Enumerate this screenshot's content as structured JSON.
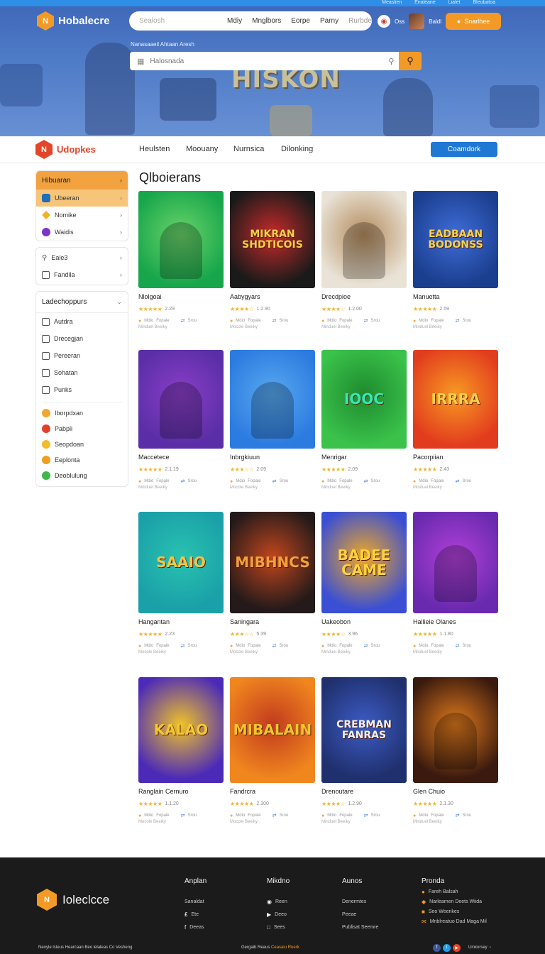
{
  "hero": {
    "top_links": [
      "Measlien",
      "Enaleane",
      "Lialet",
      "Bleubatoa"
    ],
    "brand": "Hobalecre",
    "search_placeholder": "Sealosh",
    "nav": [
      "Mdiy",
      "Mnglbors",
      "Eorpe",
      "Parny",
      "Rurbde"
    ],
    "user_text": "Oss",
    "user_name": "Baldl",
    "cta": "Snarlhee",
    "caption": "Nanasaaeil Ahtaan Aresh",
    "search_input_placeholder": "Halosnada",
    "banner_text": "HISKON"
  },
  "subnav": {
    "brand": "Udopkes",
    "links": [
      "Heulsten",
      "Moouany",
      "Nurnsica",
      "Dilonking"
    ],
    "button": "Coamdork"
  },
  "sidebar": {
    "featured_head": "Hibuaran",
    "featured_items": [
      "Ubeeran",
      "Nomike",
      "Waidis"
    ],
    "misc_items": [
      "Eale3",
      "Fandila"
    ],
    "categories_title": "Ladechoppurs",
    "categories": [
      "Autdra",
      "Drecegjan",
      "Pereeran",
      "Sohatan",
      "Punks"
    ],
    "tags": [
      {
        "label": "Iborpdxan",
        "color": "#f2a830"
      },
      {
        "label": "Pabpli",
        "color": "#e3402a"
      },
      {
        "label": "Seopdoan",
        "color": "#f4bb2a"
      },
      {
        "label": "Eeplonta",
        "color": "#f29e20"
      },
      {
        "label": "Deoblulung",
        "color": "#3fb84a"
      }
    ]
  },
  "main": {
    "title": "Qlboierans",
    "meta_left": "Mdio",
    "meta_mid": "Fopale",
    "meta_right": "Srou",
    "games": [
      {
        "name": "Nlolgoai",
        "score": "2.29",
        "rating": 5,
        "sub": "Minduel Beeiky",
        "art": ""
      },
      {
        "name": "Aabygyars",
        "score": "1.2.90",
        "rating": 4,
        "sub": "Mocole Beeiky",
        "art": "MIKRAN SHDTICOIS"
      },
      {
        "name": "Drecdpioe",
        "score": "1.2.00",
        "rating": 4,
        "sub": "Minduel Beeiky",
        "art": ""
      },
      {
        "name": "Manuetta",
        "score": "2.59",
        "rating": 5,
        "sub": "Minduel Beeiky",
        "art": "EADBAAN BODONSS"
      },
      {
        "name": "Maccetece",
        "score": "2.1.19",
        "rating": 5,
        "sub": "Minduel Beeiky",
        "art": ""
      },
      {
        "name": "Inbrgkiuun",
        "score": "2.09",
        "rating": 3,
        "sub": "Mocole Beeiky",
        "art": ""
      },
      {
        "name": "Menrigar",
        "score": "2.09",
        "rating": 5,
        "sub": "Minduel Beeiky",
        "art": "IOOC"
      },
      {
        "name": "Pacorpiian",
        "score": "2.43",
        "rating": 5,
        "sub": "Minduel Beeiky",
        "art": "IRRRA"
      },
      {
        "name": "Hangantan",
        "score": "2.23",
        "rating": 5,
        "sub": "Mocole Beeiky",
        "art": "SAAIO"
      },
      {
        "name": "Saningara",
        "score": "5.39",
        "rating": 3,
        "sub": "Mocole Beeiky",
        "art": "MIBHNCS"
      },
      {
        "name": "Uakeobon",
        "score": "3.96",
        "rating": 4,
        "sub": "Minduel Beeiky",
        "art": "BADEE CAME"
      },
      {
        "name": "Hallieie Olanes",
        "score": "1.1.80",
        "rating": 5,
        "sub": "Minduel Beeiky",
        "art": ""
      },
      {
        "name": "Ranglain Cernuro",
        "score": "1.1.20",
        "rating": 5,
        "sub": "Mocole Beeiky",
        "art": "KALAO"
      },
      {
        "name": "Fandrcra",
        "score": "2.300",
        "rating": 5,
        "sub": "Mocole Beeiky",
        "art": "MIBALAIN"
      },
      {
        "name": "Drenoutare",
        "score": "1.2.90",
        "rating": 4,
        "sub": "Minduel Beeiky",
        "art": "CREBMAN FANRAS"
      },
      {
        "name": "Glen Chuio",
        "score": "2.1.30",
        "rating": 5,
        "sub": "Minduel Beeiky",
        "art": ""
      }
    ]
  },
  "footer": {
    "brand": "Ioleclcce",
    "cols": [
      {
        "title": "Anplan",
        "items": [
          "Sanaldat",
          "Ete",
          "Deeas"
        ]
      },
      {
        "title": "Mikdno",
        "items": [
          "Reen",
          "Deeo",
          "Sees"
        ]
      },
      {
        "title": "Aunos",
        "items": [
          "Denermtes",
          "Peeae",
          "Publisat Seemre"
        ]
      },
      {
        "title": "Pronda",
        "items": [
          "Fareh Balsah",
          "Narleamen Deets Wiida",
          "Seo Weenkes",
          "Mnblreatuo Dad Maga Mil"
        ]
      }
    ],
    "bottom_left": "Neoyle lsteus Hearcaan Beo lelaleas Co Vesheng",
    "bottom_mid_a": "Gergaib Reaus",
    "bottom_mid_b": "Ceasaiu Ruerk",
    "bottom_right": "Uinkorsey"
  }
}
